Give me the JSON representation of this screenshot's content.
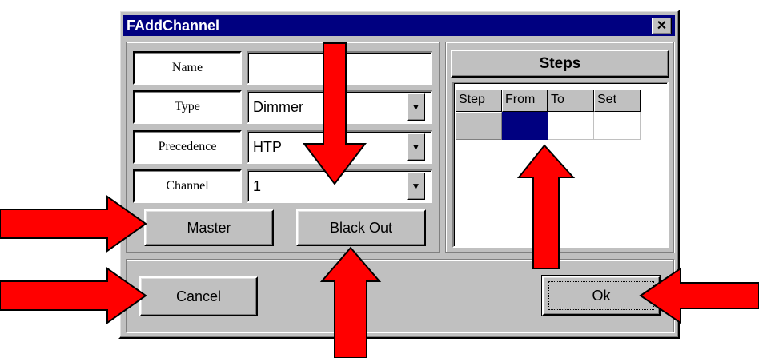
{
  "window": {
    "title": "FAddChannel",
    "close_glyph": "✕"
  },
  "form": {
    "name": {
      "label": "Name",
      "value": ""
    },
    "type": {
      "label": "Type",
      "value": "Dimmer"
    },
    "precedence": {
      "label": "Precedence",
      "value": "HTP"
    },
    "channel": {
      "label": "Channel",
      "value": "1"
    }
  },
  "buttons": {
    "master": "Master",
    "blackout": "Black Out",
    "cancel": "Cancel",
    "ok": "Ok"
  },
  "steps": {
    "title": "Steps",
    "columns": [
      "Step",
      "From",
      "To",
      "Set"
    ],
    "selected_cell_color": "#000080"
  },
  "colors": {
    "title_bar": "#000080",
    "face": "#c0c0c0",
    "arrow": "#ff0000"
  },
  "icons": {
    "dropdown": "triangle-down",
    "close": "close-x"
  }
}
